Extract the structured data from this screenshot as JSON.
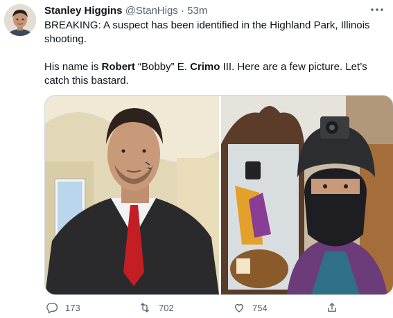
{
  "tweet": {
    "author": {
      "display_name": "Stanley Higgins",
      "handle": "@StanHigs",
      "separator": "·",
      "time": "53m"
    },
    "line1": "BREAKING: A suspect has been identified in the Highland Park, Illinois shooting.",
    "line2": {
      "t1": "His name is ",
      "b1": "Robert",
      "t2": " “Bobby” E. ",
      "b2": "Crimo",
      "t3": " III. Here are a few picture. Let’s catch this bastard."
    },
    "media_icons": [
      "selfie-in-suit-photo",
      "selfie-with-helmet-photo"
    ],
    "actions": {
      "reply_count": "173",
      "retweet_count": "702",
      "like_count": "754"
    }
  }
}
